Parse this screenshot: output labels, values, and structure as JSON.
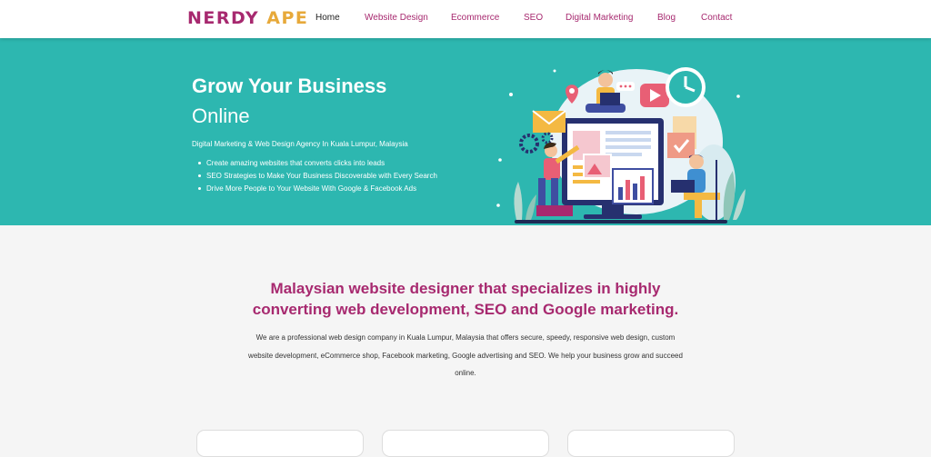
{
  "brand": {
    "part1": "NERDY",
    "part2": "APE"
  },
  "nav": [
    {
      "label": "Home",
      "active": true
    },
    {
      "label": "Website Design"
    },
    {
      "label": "Ecommerce"
    },
    {
      "label": "SEO"
    },
    {
      "label": "Digital Marketing"
    },
    {
      "label": "Blog"
    },
    {
      "label": "Contact"
    }
  ],
  "hero": {
    "title": "Grow Your Business",
    "subtitle": "Online",
    "tagline": "Digital Marketing & Web Design Agency In Kuala Lumpur, Malaysia",
    "bullets": [
      "Create amazing websites that converts clicks into leads",
      "SEO Strategies to Make Your Business Discoverable with Every Search",
      "Drive More People to Your Website With Google & Facebook Ads"
    ]
  },
  "intro": {
    "headline_line1": "Malaysian website designer that specializes in highly",
    "headline_line2": "converting web development, SEO and Google marketing.",
    "description": "We are a professional web design company in Kuala Lumpur, Malaysia that offers secure, speedy, responsive web design, custom website development, eCommerce shop, Facebook marketing, Google advertising and SEO. We help your business grow and succeed online."
  },
  "colors": {
    "brand_primary": "#a7296f",
    "brand_secondary": "#e7a93a",
    "hero_bg": "#2db7b0"
  }
}
